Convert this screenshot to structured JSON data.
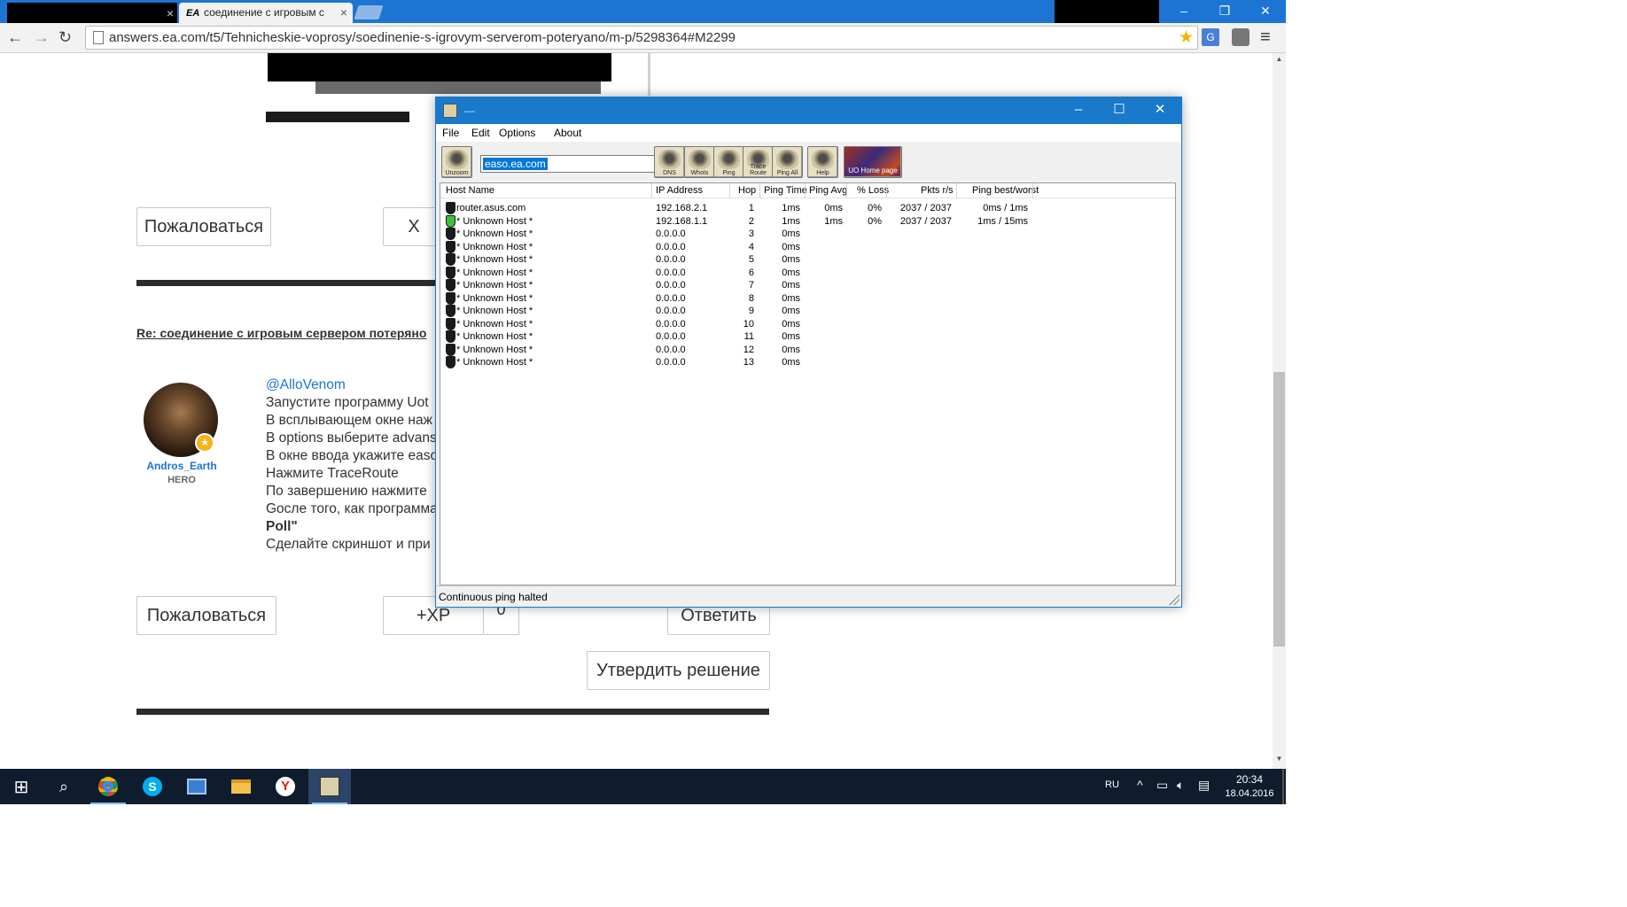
{
  "browser": {
    "tabs": [
      {
        "title": "",
        "active": false
      },
      {
        "title": "соединение с игровым с",
        "favicon": "EA",
        "active": true
      }
    ],
    "url": "answers.ea.com/t5/Tehnicheskie-voprosy/soedinenie-s-igrovym-serverom-poteryano/m-p/5298364#M2299",
    "translate_label": "G"
  },
  "page": {
    "buttons_top": {
      "report": "Пожаловаться",
      "kudos_partial": "X"
    },
    "reply_title": "Re: соединение с игровым сервером потеряно",
    "author": {
      "name": "Andros_Earth",
      "rank": "HERO"
    },
    "post_lines": [
      "@AlloVenom",
      "Запустите программу Uot",
      "В всплывающем окне наж",
      "В options выберите advans",
      "В окне ввода укажите easo",
      "Нажмите TraceRoute",
      "По завершению нажмите",
      "Gосле того, как программа",
      "Poll\"",
      "Сделайте скриншот и при"
    ],
    "buttons_bottom": {
      "report": "Пожаловаться",
      "xp": "+XP",
      "xp_count": "0",
      "reply": "Ответить",
      "accept_solution": "Утвердить решение"
    }
  },
  "winmtr": {
    "title": "—",
    "menu": [
      "File",
      "Edit",
      "Options",
      "About"
    ],
    "host": "easo.ea.com",
    "tools": [
      "Unzoom",
      "DNS",
      "WhoIs",
      "Ping",
      "Trace Route",
      "Ping All",
      "Help",
      "UO Home page"
    ],
    "columns": [
      "Host Name",
      "IP Address",
      "Hop",
      "Ping Time",
      "Ping Avg",
      "% Loss",
      "Pkts r/s",
      "Ping best/worst"
    ],
    "rows": [
      {
        "host": "router.asus.com",
        "ip": "192.168.2.1",
        "hop": "1",
        "ping": "1ms",
        "avg": "0ms",
        "loss": "0%",
        "pkts": "2037 / 2037",
        "bw": "0ms / 1ms",
        "ok": false
      },
      {
        "host": "* Unknown Host *",
        "ip": "192.168.1.1",
        "hop": "2",
        "ping": "1ms",
        "avg": "1ms",
        "loss": "0%",
        "pkts": "2037 / 2037",
        "bw": "1ms / 15ms",
        "ok": true
      },
      {
        "host": "* Unknown Host *",
        "ip": "0.0.0.0",
        "hop": "3",
        "ping": "0ms",
        "avg": "",
        "loss": "",
        "pkts": "",
        "bw": "",
        "ok": false
      },
      {
        "host": "* Unknown Host *",
        "ip": "0.0.0.0",
        "hop": "4",
        "ping": "0ms",
        "avg": "",
        "loss": "",
        "pkts": "",
        "bw": "",
        "ok": false
      },
      {
        "host": "* Unknown Host *",
        "ip": "0.0.0.0",
        "hop": "5",
        "ping": "0ms",
        "avg": "",
        "loss": "",
        "pkts": "",
        "bw": "",
        "ok": false
      },
      {
        "host": "* Unknown Host *",
        "ip": "0.0.0.0",
        "hop": "6",
        "ping": "0ms",
        "avg": "",
        "loss": "",
        "pkts": "",
        "bw": "",
        "ok": false
      },
      {
        "host": "* Unknown Host *",
        "ip": "0.0.0.0",
        "hop": "7",
        "ping": "0ms",
        "avg": "",
        "loss": "",
        "pkts": "",
        "bw": "",
        "ok": false
      },
      {
        "host": "* Unknown Host *",
        "ip": "0.0.0.0",
        "hop": "8",
        "ping": "0ms",
        "avg": "",
        "loss": "",
        "pkts": "",
        "bw": "",
        "ok": false
      },
      {
        "host": "* Unknown Host *",
        "ip": "0.0.0.0",
        "hop": "9",
        "ping": "0ms",
        "avg": "",
        "loss": "",
        "pkts": "",
        "bw": "",
        "ok": false
      },
      {
        "host": "* Unknown Host *",
        "ip": "0.0.0.0",
        "hop": "10",
        "ping": "0ms",
        "avg": "",
        "loss": "",
        "pkts": "",
        "bw": "",
        "ok": false
      },
      {
        "host": "* Unknown Host *",
        "ip": "0.0.0.0",
        "hop": "11",
        "ping": "0ms",
        "avg": "",
        "loss": "",
        "pkts": "",
        "bw": "",
        "ok": false
      },
      {
        "host": "* Unknown Host *",
        "ip": "0.0.0.0",
        "hop": "12",
        "ping": "0ms",
        "avg": "",
        "loss": "",
        "pkts": "",
        "bw": "",
        "ok": false
      },
      {
        "host": "* Unknown Host *",
        "ip": "0.0.0.0",
        "hop": "13",
        "ping": "0ms",
        "avg": "",
        "loss": "",
        "pkts": "",
        "bw": "",
        "ok": false
      }
    ],
    "status": "Continuous ping halted"
  },
  "taskbar": {
    "language": "RU",
    "time": "20:34",
    "date": "18.04.2016",
    "apps": [
      "chrome-icon",
      "skype-icon",
      "control-panel-icon",
      "file-explorer-icon",
      "yandex-icon",
      "winmtr-icon"
    ]
  },
  "colors": {
    "chrome_blue": "#1c75d2",
    "taskbar": "#0f1c2e",
    "accent": "#1979ca"
  }
}
